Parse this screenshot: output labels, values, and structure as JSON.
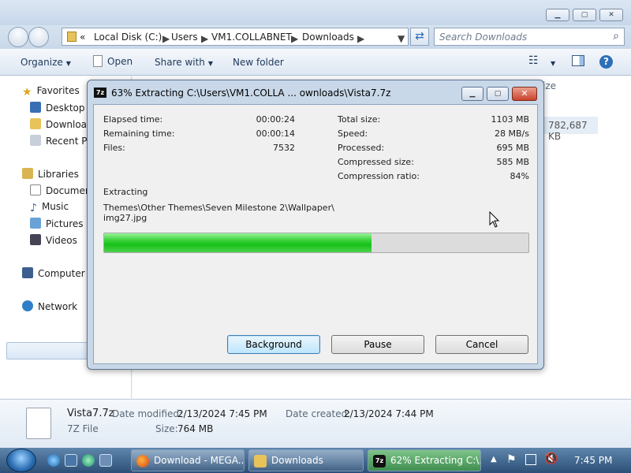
{
  "explorer": {
    "address": {
      "overflow": "«",
      "crumbs": [
        "Local Disk (C:)",
        "Users",
        "VM1.COLLABNET",
        "Downloads"
      ]
    },
    "search_placeholder": "Search Downloads",
    "toolbar": {
      "organize": "Organize",
      "open": "Open",
      "share_with": "Share with",
      "new_folder": "New folder"
    },
    "nav": {
      "favorites": "Favorites",
      "desktop": "Desktop",
      "downloads": "Downloads",
      "recent_places": "Recent Places",
      "libraries": "Libraries",
      "documents": "Documents",
      "music": "Music",
      "pictures": "Pictures",
      "videos": "Videos",
      "computer": "Computer",
      "network": "Network"
    },
    "column_header_partial": "ize",
    "size_value": "782,687 KB",
    "details": {
      "name": "Vista7.7z",
      "type": "7Z File",
      "modified_label": "Date modified:",
      "modified_value": "2/13/2024 7:45 PM",
      "created_label": "Date created:",
      "created_value": "2/13/2024 7:44 PM",
      "size_label": "Size:",
      "size_value": "764 MB"
    }
  },
  "dialog": {
    "logo": "7z",
    "title": "63% Extracting C:\\Users\\VM1.COLLA ... ownloads\\Vista7.7z",
    "left_stats": [
      {
        "label": "Elapsed time:",
        "value": "00:00:24"
      },
      {
        "label": "Remaining time:",
        "value": "00:00:14"
      },
      {
        "label": "Files:",
        "value": "7532"
      }
    ],
    "right_stats": [
      {
        "label": "Total size:",
        "value": "1103 MB"
      },
      {
        "label": "Speed:",
        "value": "28 MB/s"
      },
      {
        "label": "Processed:",
        "value": "695 MB"
      },
      {
        "label": "Compressed size:",
        "value": "585 MB"
      },
      {
        "label": "Compression ratio:",
        "value": "84%"
      }
    ],
    "extracting_label": "Extracting",
    "current_path_line1": "Themes\\Other Themes\\Seven Milestone 2\\Wallpaper\\",
    "current_path_line2": "img27.jpg",
    "progress": 0.63,
    "buttons": {
      "background": "Background",
      "pause": "Pause",
      "cancel": "Cancel"
    }
  },
  "taskbar": {
    "tasks": [
      {
        "label": "Download - MEGA..."
      },
      {
        "label": "Downloads"
      },
      {
        "label": "62% Extracting C:\\..."
      }
    ],
    "clock": "7:45 PM"
  },
  "colors": {
    "progress_green": "#17c017",
    "titlebar": "#c6d7ea",
    "taskbar": "#2c4f76"
  }
}
